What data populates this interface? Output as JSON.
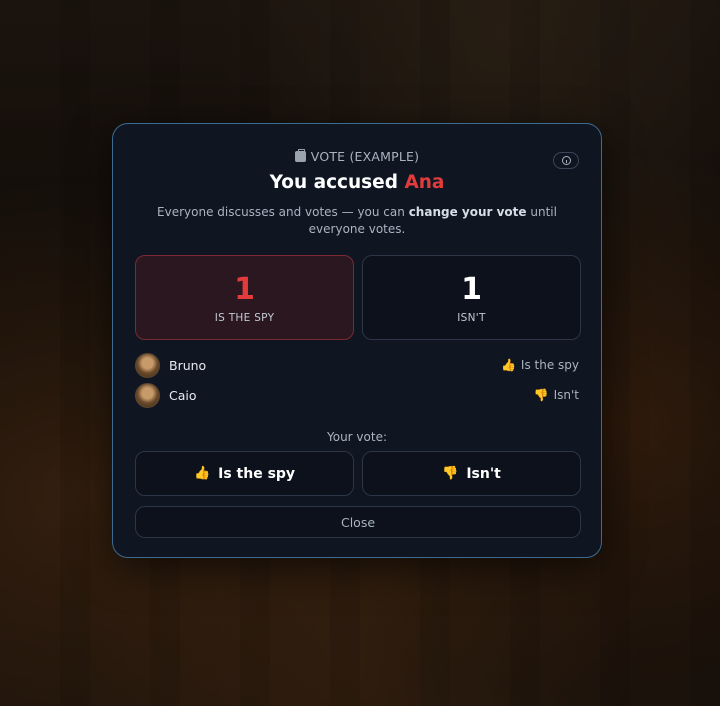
{
  "modal": {
    "kicker": "VOTE (EXAMPLE)",
    "title_prefix": "You accused",
    "accused_name": "Ana",
    "desc_before": "Everyone discusses and votes — you can",
    "desc_bold": "change your vote",
    "desc_after": "until everyone votes."
  },
  "tally": {
    "spy": {
      "count": "1",
      "label": "IS THE SPY"
    },
    "not": {
      "count": "1",
      "label": "ISN'T"
    }
  },
  "voters": [
    {
      "name": "Bruno",
      "vote_label": "Is the spy",
      "vote_icon": "👍"
    },
    {
      "name": "Caio",
      "vote_label": "Isn't",
      "vote_icon": "👎"
    }
  ],
  "your_vote": {
    "label": "Your vote:",
    "yes_label": "Is the spy",
    "yes_icon": "👍",
    "no_label": "Isn't",
    "no_icon": "👎"
  },
  "close_label": "Close",
  "colors": {
    "accent_red": "#e23b3b",
    "border_blue": "#3b6a92"
  }
}
